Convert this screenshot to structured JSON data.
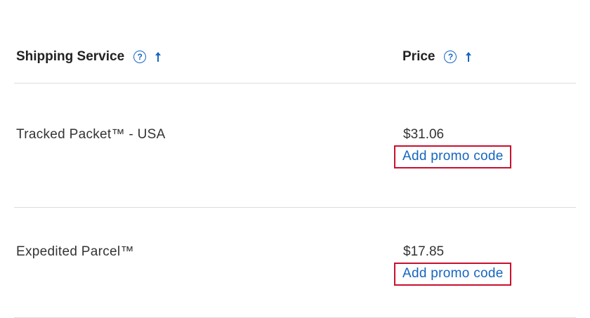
{
  "table": {
    "headers": {
      "service": "Shipping Service",
      "price": "Price",
      "help_glyph": "?",
      "help_icon": "question-circle-icon",
      "sort_icon": "arrow-up-icon"
    },
    "rows": [
      {
        "service": "Tracked Packet™ - USA",
        "price": "$31.06",
        "promo_label": "Add promo code"
      },
      {
        "service": "Expedited Parcel™",
        "price": "$17.85",
        "promo_label": "Add promo code"
      }
    ]
  },
  "colors": {
    "link": "#1565c0",
    "highlight_border": "#c8102e",
    "divider": "#dddddd"
  }
}
